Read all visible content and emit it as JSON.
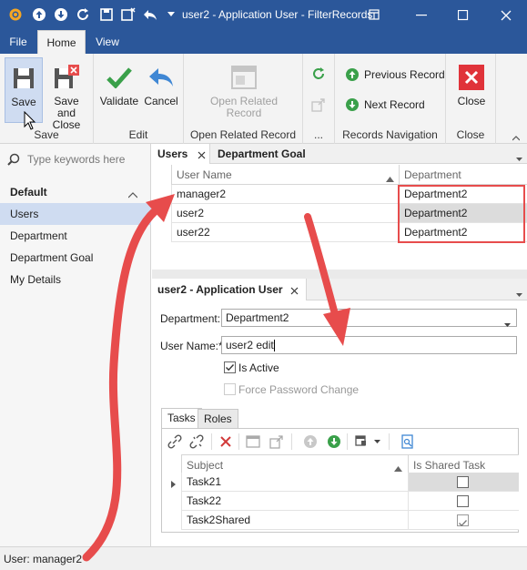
{
  "window": {
    "title": "user2 - Application User - FilterRecords"
  },
  "ribbon": {
    "tabs": [
      "File",
      "Home",
      "View"
    ],
    "active_tab": "Home",
    "save_group": {
      "label": "Save",
      "save": "Save",
      "save_close_1": "Save and",
      "save_close_2": "Close"
    },
    "edit_group": {
      "label": "Edit",
      "validate": "Validate",
      "cancel": "Cancel"
    },
    "open_related_group": {
      "label": "Open Related Record",
      "button_1": "Open Related",
      "button_2": "Record"
    },
    "misc_group": {
      "label": "..."
    },
    "records_nav_group": {
      "label": "Records Navigation",
      "previous": "Previous Record",
      "next": "Next Record"
    },
    "close_group": {
      "label": "Close",
      "close": "Close"
    }
  },
  "nav": {
    "search_placeholder": "Type keywords here",
    "group": "Default",
    "items": [
      "Users",
      "Department",
      "Department Goal",
      "My Details"
    ],
    "selected": "Users"
  },
  "users_view": {
    "tabs": [
      "Users",
      "Department Goal"
    ],
    "columns": [
      "User Name",
      "Department"
    ],
    "rows": [
      {
        "user": "manager2",
        "department": "Department2"
      },
      {
        "user": "user2",
        "department": "Department2"
      },
      {
        "user": "user22",
        "department": "Department2"
      }
    ]
  },
  "detail_view": {
    "tab": "user2 - Application User",
    "department_label": "Department:",
    "department_value": "Department2",
    "username_label": "User Name:*",
    "username_value": "user2 edit",
    "is_active_label": "Is Active",
    "is_active": true,
    "force_pwd_label": "Force Password Change",
    "force_pwd": false,
    "inner_tabs": [
      "Tasks",
      "Roles"
    ],
    "task_columns": [
      "Subject",
      "Is Shared Task"
    ],
    "tasks": [
      {
        "subject": "Task21",
        "shared": false
      },
      {
        "subject": "Task22",
        "shared": false
      },
      {
        "subject": "Task2Shared",
        "shared": true
      }
    ]
  },
  "status": {
    "text": "User: manager2"
  },
  "colors": {
    "titlebar": "#2b579a",
    "accent_red": "#e74c4c",
    "selection": "#cfdcf1"
  }
}
